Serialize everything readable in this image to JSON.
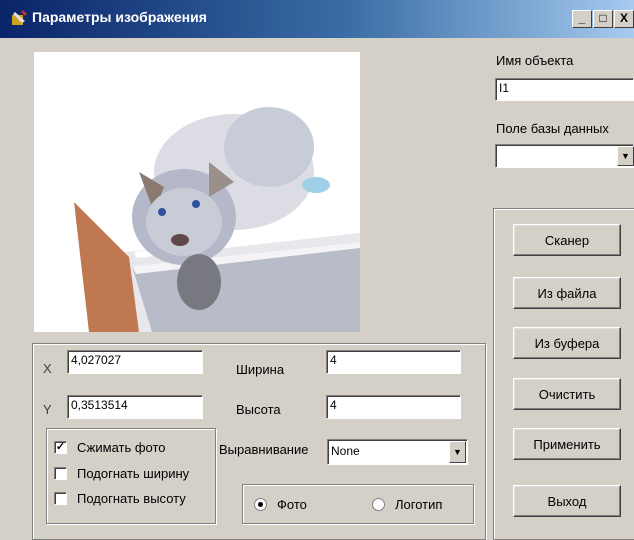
{
  "window": {
    "title": "Параметры изображения",
    "minimize": "_",
    "maximize": "□",
    "close": "X"
  },
  "image_preview": {
    "description_icon": "kitten-photo"
  },
  "right_panel": {
    "object_name_label": "Имя объекта",
    "object_name_value": "I1",
    "db_field_label": "Поле базы данных",
    "db_field_value": ""
  },
  "buttons": {
    "scanner": "Сканер",
    "from_file": "Из файла",
    "from_buffer": "Из буфера",
    "clear": "Очистить",
    "apply": "Применить",
    "exit": "Выход"
  },
  "fields": {
    "x_label": "X",
    "x_value": "4,027027",
    "y_label": "Y",
    "y_value": "0,3513514",
    "width_label": "Ширина",
    "width_value": "4",
    "height_label": "Высота",
    "height_value": "4",
    "align_label": "Выравнивание",
    "align_value": "None"
  },
  "checkboxes": [
    {
      "label": "Сжимать фото",
      "checked": true,
      "mark": "✓"
    },
    {
      "label": "Подогнать ширину",
      "checked": false,
      "mark": ""
    },
    {
      "label": "Подогнать высоту",
      "checked": false,
      "mark": ""
    }
  ],
  "radios": [
    {
      "label": "Фото",
      "selected": true
    },
    {
      "label": "Логотип",
      "selected": false
    }
  ]
}
